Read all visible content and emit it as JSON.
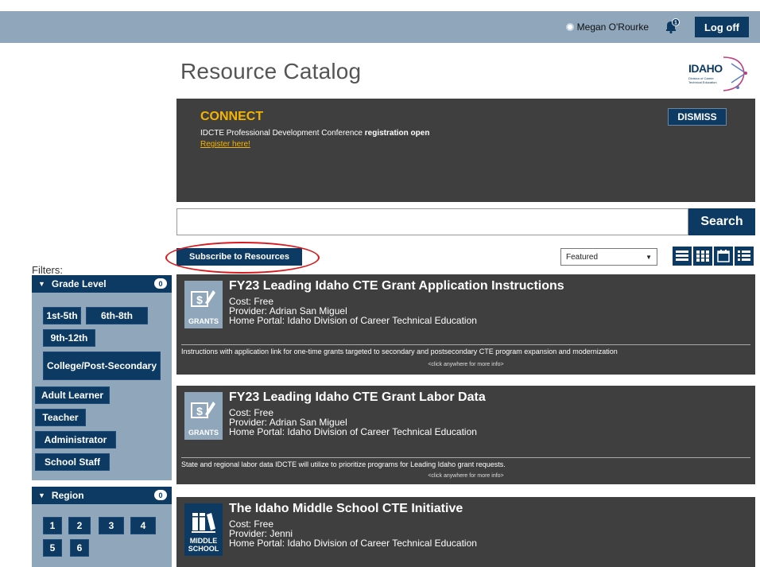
{
  "topbar": {
    "user_name": "Megan O'Rourke",
    "notifications": "1",
    "logoff_label": "Log off"
  },
  "header": {
    "title": "Resource Catalog",
    "logo_text": "IDAHO",
    "logo_sub": "Division of Career Technical Education"
  },
  "announcement": {
    "heading": "CONNECT",
    "text_plain": "IDCTE Professional Development Conference ",
    "text_bold": "registration open",
    "link": "Register here!",
    "dismiss_label": "DISMISS"
  },
  "search": {
    "value": "",
    "placeholder": "",
    "button_label": "Search"
  },
  "toolbar": {
    "subscribe_label": "Subscribe to Resources",
    "sort_selected": "Featured"
  },
  "filters": {
    "label": "Filters:",
    "grade": {
      "title": "Grade Level",
      "count": "0",
      "items": [
        "1st-5th",
        "6th-8th",
        "9th-12th",
        "College/Post-Secondary",
        "Adult Learner",
        "Teacher",
        "Administrator",
        "School Staff"
      ]
    },
    "region": {
      "title": "Region",
      "count": "0",
      "items": [
        "1",
        "2",
        "3",
        "4",
        "5",
        "6"
      ]
    }
  },
  "resources": [
    {
      "title": "FY23 Leading Idaho CTE Grant Application Instructions",
      "cost": "Cost: Free",
      "provider": "Provider: Adrian San Miguel",
      "portal": "Home Portal: Idaho Division of Career Technical Education",
      "category": "GRANTS",
      "description": "Instructions with application link for one-time grants targeted to secondary and postsecondary CTE program expansion and modernization",
      "more": "<click anywhere for more info>"
    },
    {
      "title": "FY23 Leading Idaho CTE Grant Labor Data",
      "cost": "Cost: Free",
      "provider": "Provider: Adrian San Miguel",
      "portal": "Home Portal: Idaho Division of Career Technical Education",
      "category": "GRANTS",
      "description": "State and regional labor data IDCTE will utilize to prioritize programs for Leading Idaho grant requests.",
      "more": "<click anywhere for more info>"
    },
    {
      "title": "The Idaho Middle School CTE Initiative",
      "cost": "Cost: Free",
      "provider": "Provider: Jenni",
      "portal": "Home Portal: Idaho Division of Career Technical Education",
      "category": "MIDDLE SCHOOL"
    }
  ],
  "colors": {
    "navy": "#0c3a63",
    "slate": "#8fa6bb",
    "card_bg": "#3f3f3f",
    "accent": "#f4b400",
    "highlight": "#d9191c"
  }
}
